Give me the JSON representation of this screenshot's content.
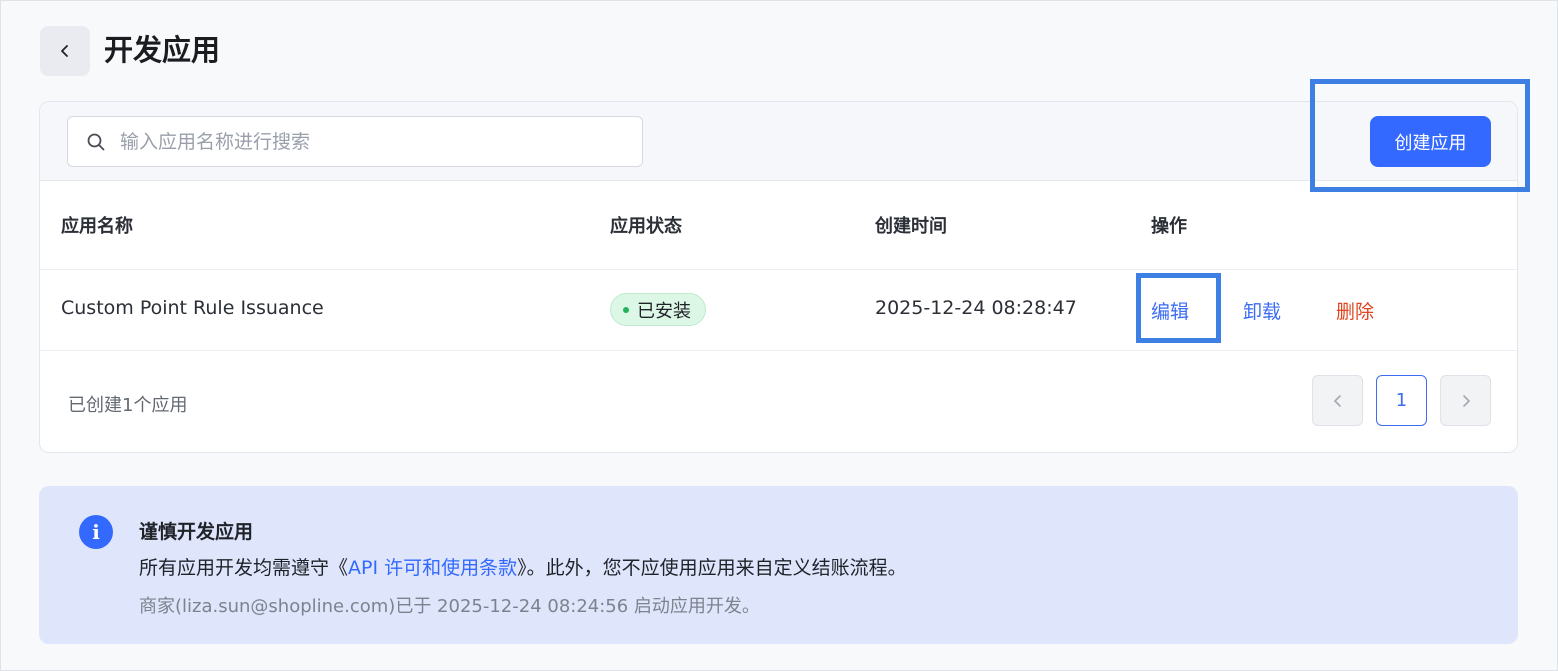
{
  "header": {
    "back_icon": "chevron-left-icon",
    "title": "开发应用"
  },
  "toolbar": {
    "search_placeholder": "输入应用名称进行搜索",
    "search_value": "",
    "create_label": "创建应用"
  },
  "table": {
    "columns": [
      "应用名称",
      "应用状态",
      "创建时间",
      "操作"
    ],
    "rows": [
      {
        "name": "Custom Point Rule Issuance",
        "status": "已安装",
        "created": "2025-12-24 08:28:47",
        "actions": {
          "edit": "编辑",
          "uninstall": "卸载",
          "delete": "删除"
        }
      }
    ]
  },
  "footer": {
    "count_text": "已创建1个应用",
    "current_page": "1"
  },
  "notice": {
    "icon": "info-icon",
    "title": "谨慎开发应用",
    "body_prefix": "所有应用开发均需遵守《",
    "body_link": "API 许可和使用条款",
    "body_suffix": "》。此外，您不应使用应用来自定义结账流程。",
    "meta": "商家(liza.sun@shopline.com)已于 2025-12-24 08:24:56 启动应用开发。"
  },
  "colors": {
    "primary": "#3369ff",
    "link": "#3c6cf2",
    "danger": "#e0451f",
    "success_badge_bg": "#dcf7e6",
    "notice_bg": "#dfe5fb",
    "highlight": "#3d7fe3"
  }
}
